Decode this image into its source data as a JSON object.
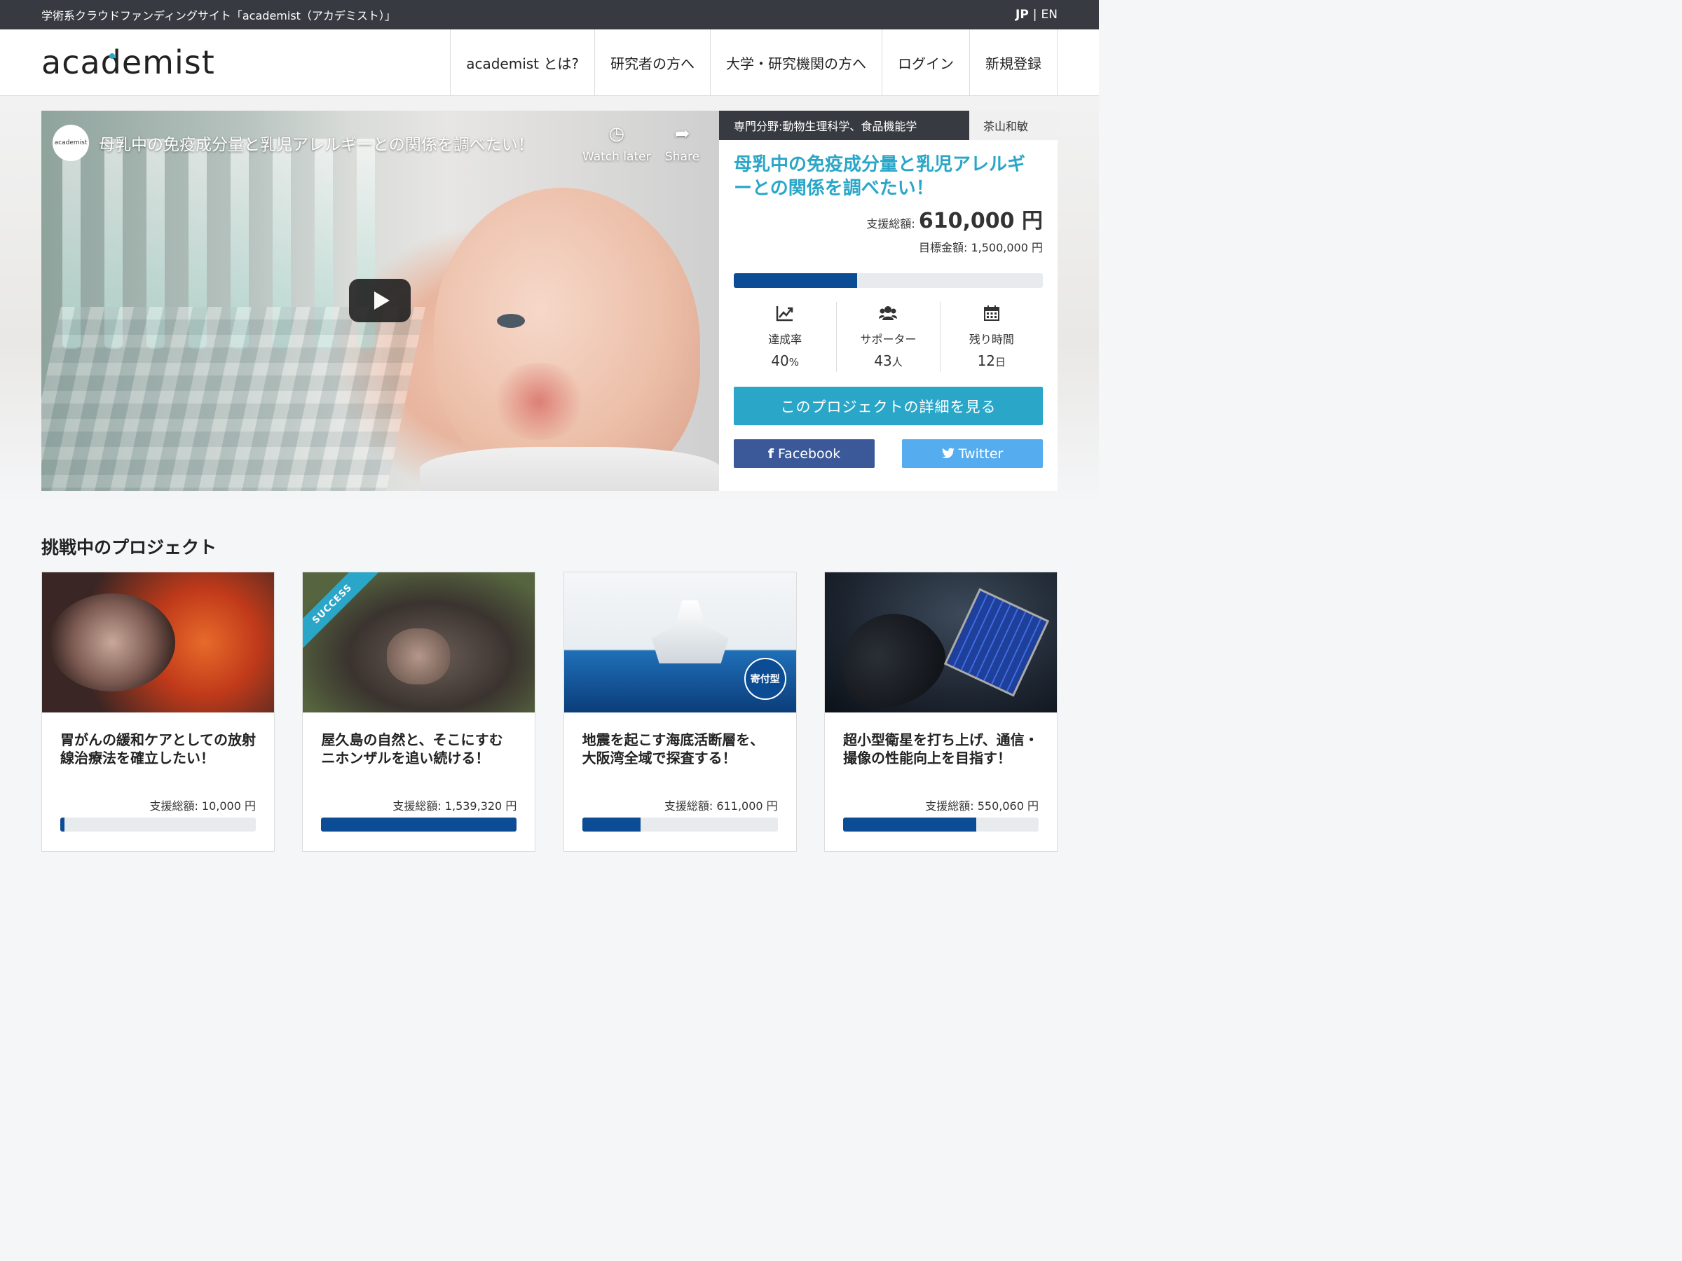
{
  "topbar": {
    "tagline": "学術系クラウドファンディングサイト「academist（アカデミスト）」",
    "lang_jp": "JP",
    "lang_sep": "|",
    "lang_en": "EN"
  },
  "header": {
    "logo": "academist",
    "nav": [
      "academist とは?",
      "研究者の方へ",
      "大学・研究機関の方へ",
      "ログイン",
      "新規登録"
    ]
  },
  "video": {
    "channel": "academist",
    "title": "母乳中の免疫成分量と乳児アレルギーとの関係を調べたい！",
    "watch_later": "Watch later",
    "share": "Share"
  },
  "featured": {
    "field": "専門分野:動物生理科学、食品機能学",
    "researcher": "茶山和敏",
    "title": "母乳中の免疫成分量と乳児アレルギーとの関係を調べたい！",
    "amount_label": "支援総額:",
    "amount_value": "610,000 円",
    "goal": "目標金額: 1,500,000 円",
    "progress": 0.4,
    "stats": [
      {
        "icon": "chart-line-icon",
        "label": "達成率",
        "value": "40",
        "unit": "%"
      },
      {
        "icon": "users-icon",
        "label": "サポーター",
        "value": "43",
        "unit": "人"
      },
      {
        "icon": "calendar-icon",
        "label": "残り時間",
        "value": "12",
        "unit": "日"
      }
    ],
    "detail_button": "このプロジェクトの詳細を見る",
    "facebook": "Facebook",
    "twitter": "Twitter"
  },
  "section": {
    "title": "挑戦中のプロジェクト"
  },
  "cards": [
    {
      "title": "胃がんの緩和ケアとしての放射線治療法を確立したい！",
      "amount": "支援総額: 10,000 円",
      "progress": 0.02
    },
    {
      "title": "屋久島の自然と、そこにすむニホンザルを追い続ける！",
      "amount": "支援総額: 1,539,320 円",
      "progress": 1.0,
      "ribbon": "SUCCESS"
    },
    {
      "title": "地震を起こす海底活断層を、大阪湾全域で探査する！",
      "amount": "支援総額: 611,000 円",
      "progress": 0.3,
      "badge": "寄付型"
    },
    {
      "title": "超小型衛星を打ち上げ、通信・撮像の性能向上を目指す！",
      "amount": "支援総額: 550,060 円",
      "progress": 0.68
    }
  ],
  "colors": {
    "accent": "#2aa6c8",
    "navy": "#0b4c94",
    "dark": "#373b41",
    "facebook": "#3b5998",
    "twitter": "#55acee"
  }
}
